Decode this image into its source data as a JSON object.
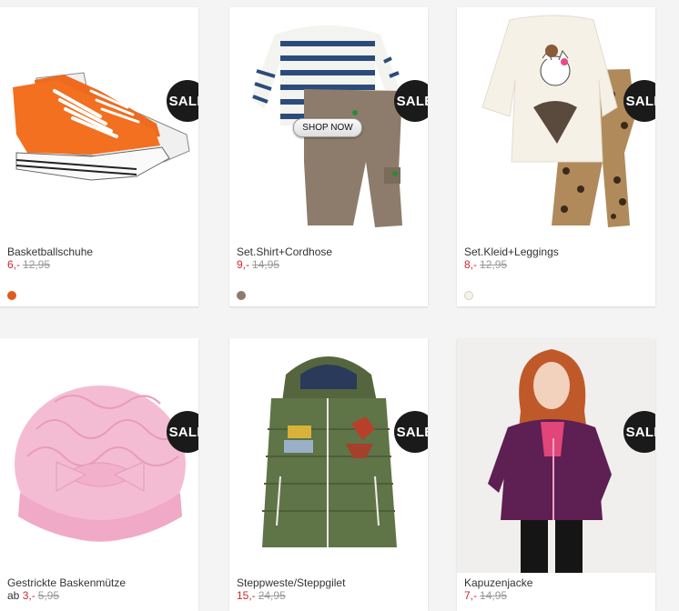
{
  "badge": "SALE",
  "shop_now": "SHOP NOW",
  "products": [
    {
      "name": "Basketballschuhe",
      "prefix": "",
      "price": "6,-",
      "old_price": "12,95",
      "swatch": "#e05a1c"
    },
    {
      "name": "Set.Shirt+Cordhose",
      "prefix": "",
      "price": "9,-",
      "old_price": "14,95",
      "swatch": "#8f7a6a"
    },
    {
      "name": "Set.Kleid+Leggings",
      "prefix": "",
      "price": "8,-",
      "old_price": "12,95",
      "swatch": "#f7f3ea"
    },
    {
      "name": "Gestrickte Baskenmütze",
      "prefix": "ab",
      "price": "3,-",
      "old_price": "5,95",
      "swatch": ""
    },
    {
      "name": "Steppweste/Steppgilet",
      "prefix": "",
      "price": "15,-",
      "old_price": "24,95",
      "swatch": ""
    },
    {
      "name": "Kapuzenjacke",
      "prefix": "",
      "price": "7,-",
      "old_price": "14,95",
      "swatch": ""
    }
  ]
}
